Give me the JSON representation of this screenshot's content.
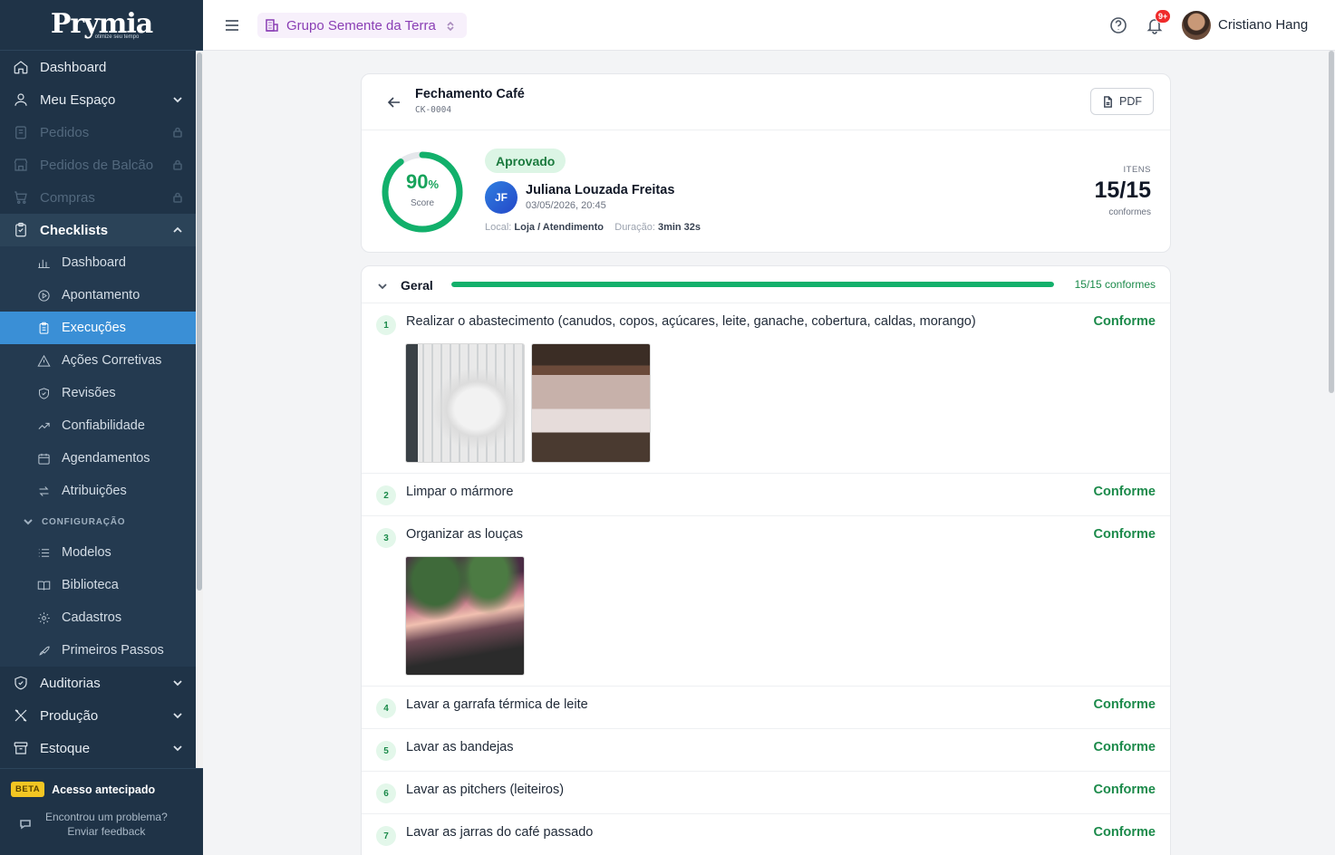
{
  "app": {
    "logo": "Prymia",
    "tagline": "otimize seu tempo"
  },
  "sidebar": {
    "items": [
      {
        "label": "Dashboard",
        "icon": "home-icon"
      },
      {
        "label": "Meu Espaço",
        "icon": "user-icon"
      },
      {
        "label": "Pedidos",
        "icon": "orders-icon",
        "locked": true
      },
      {
        "label": "Pedidos de Balcão",
        "icon": "store-icon",
        "locked": true
      },
      {
        "label": "Compras",
        "icon": "cart-icon",
        "locked": true
      },
      {
        "label": "Checklists",
        "icon": "clipboard-icon"
      }
    ],
    "checklist_sub": [
      {
        "label": "Dashboard",
        "icon": "bar-chart-icon"
      },
      {
        "label": "Apontamento",
        "icon": "play-circle-icon"
      },
      {
        "label": "Execuções",
        "icon": "clipboard-list-icon"
      },
      {
        "label": "Ações Corretivas",
        "icon": "warning-triangle-icon"
      },
      {
        "label": "Revisões",
        "icon": "shield-check-icon"
      },
      {
        "label": "Confiabilidade",
        "icon": "trend-icon"
      },
      {
        "label": "Agendamentos",
        "icon": "calendar-icon"
      },
      {
        "label": "Atribuições",
        "icon": "swap-icon"
      }
    ],
    "config_label": "CONFIGURAÇÃO",
    "config_sub": [
      {
        "label": "Modelos",
        "icon": "list-icon"
      },
      {
        "label": "Biblioteca",
        "icon": "book-icon"
      },
      {
        "label": "Cadastros",
        "icon": "gear-icon"
      },
      {
        "label": "Primeiros Passos",
        "icon": "rocket-icon"
      }
    ],
    "bottom_items": [
      {
        "label": "Auditorias",
        "icon": "shield-icon"
      },
      {
        "label": "Produção",
        "icon": "tools-icon"
      },
      {
        "label": "Estoque",
        "icon": "box-icon"
      }
    ],
    "beta_badge": "BETA",
    "beta_text": "Acesso antecipado",
    "feedback_line1": "Encontrou um problema?",
    "feedback_line2": "Enviar feedback"
  },
  "topbar": {
    "org_name": "Grupo Semente da Terra",
    "notifications": "9+",
    "user_name": "Cristiano Hang"
  },
  "execution": {
    "title": "Fechamento Café",
    "code": "CK-0004",
    "pdf_label": "PDF",
    "score_value": "90",
    "score_unit": "%",
    "score_fraction": 0.9,
    "score_label": "Score",
    "status": "Aprovado",
    "initials": "JF",
    "person": "Juliana Louzada Freitas",
    "datetime": "03/05/2026, 20:45",
    "local_label": "Local:",
    "local_value": "Loja / Atendimento",
    "duration_label": "Duração:",
    "duration_value": "3min 32s",
    "items_label": "ITENS",
    "items_value": "15/15",
    "items_sub": "conformes"
  },
  "group": {
    "name": "Geral",
    "progress": 1.0,
    "count_label": "15/15 conformes"
  },
  "items": [
    {
      "n": "1",
      "text": "Realizar o abastecimento (canudos, copos, açúcares, leite, ganache, cobertura, caldas, morango)",
      "status": "Conforme"
    },
    {
      "n": "2",
      "text": "Limpar o mármore",
      "status": "Conforme"
    },
    {
      "n": "3",
      "text": "Organizar as louças",
      "status": "Conforme"
    },
    {
      "n": "4",
      "text": "Lavar a garrafa térmica de leite",
      "status": "Conforme"
    },
    {
      "n": "5",
      "text": "Lavar as bandejas",
      "status": "Conforme"
    },
    {
      "n": "6",
      "text": "Lavar as pitchers (leiteiros)",
      "status": "Conforme"
    },
    {
      "n": "7",
      "text": "Lavar as jarras do café passado",
      "status": "Conforme"
    }
  ],
  "colors": {
    "sidebar": "#1f3347",
    "active": "#3a8fd6",
    "success": "#17a35b",
    "brand_purple": "#8a3fb5"
  }
}
